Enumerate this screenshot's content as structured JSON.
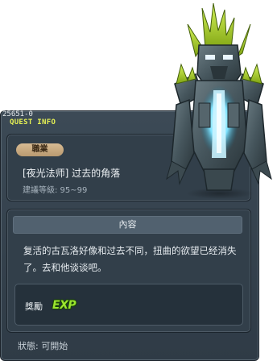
{
  "quest": {
    "id": "25651-0",
    "title": "QUEST INFO",
    "job_label": "職業",
    "job_name": "[夜光法师] 过去的角落",
    "level_text": "建議等級: 95~99",
    "content_header": "內容",
    "description": "复活的古瓦洛好像和过去不同，扭曲的欲望已经消失了。去和他谈谈吧。",
    "reward_label": "獎勵",
    "reward_exp": "EXP",
    "status": "狀態: 可開始"
  },
  "colors": {
    "window_bg": "#36434f",
    "title_accent": "#e7f254",
    "job_badge": "#c8aa80",
    "exp_green": "#9be52f",
    "monster_moss": "#a7d72a",
    "monster_glow": "#7fe3ff"
  },
  "icons": {
    "monster": "stone-golem-guwaru-icon"
  }
}
